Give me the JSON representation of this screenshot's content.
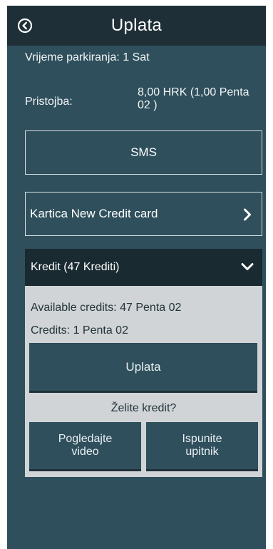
{
  "header": {
    "title": "Uplata",
    "back_icon": "circle-chevron-left-icon"
  },
  "summary": {
    "parking_time": "Vrijeme parkiranja: 1 Sat",
    "fee_label": "Pristojba:",
    "fee_value": "8,00 HRK (1,00 Penta 02 )"
  },
  "payment_options": {
    "sms_label": "SMS",
    "card_label": "Kartica New Credit card",
    "card_chevron_icon": "chevron-right-icon"
  },
  "credit": {
    "header_label": "Kredit (47 Krediti)",
    "header_icon": "chevron-down-icon",
    "available": "Available credits: 47 Penta 02",
    "credits": "Credits: 1 Penta 02",
    "pay_label": "Uplata",
    "want_credit": "Želite kredit?",
    "watch_video": "Pogledajte\nvideo",
    "fill_survey": "Ispunite\nupitnik"
  },
  "colors": {
    "background": "#2f4f5c",
    "topbar": "#1e2f37",
    "panel": "#d0d4d6"
  }
}
